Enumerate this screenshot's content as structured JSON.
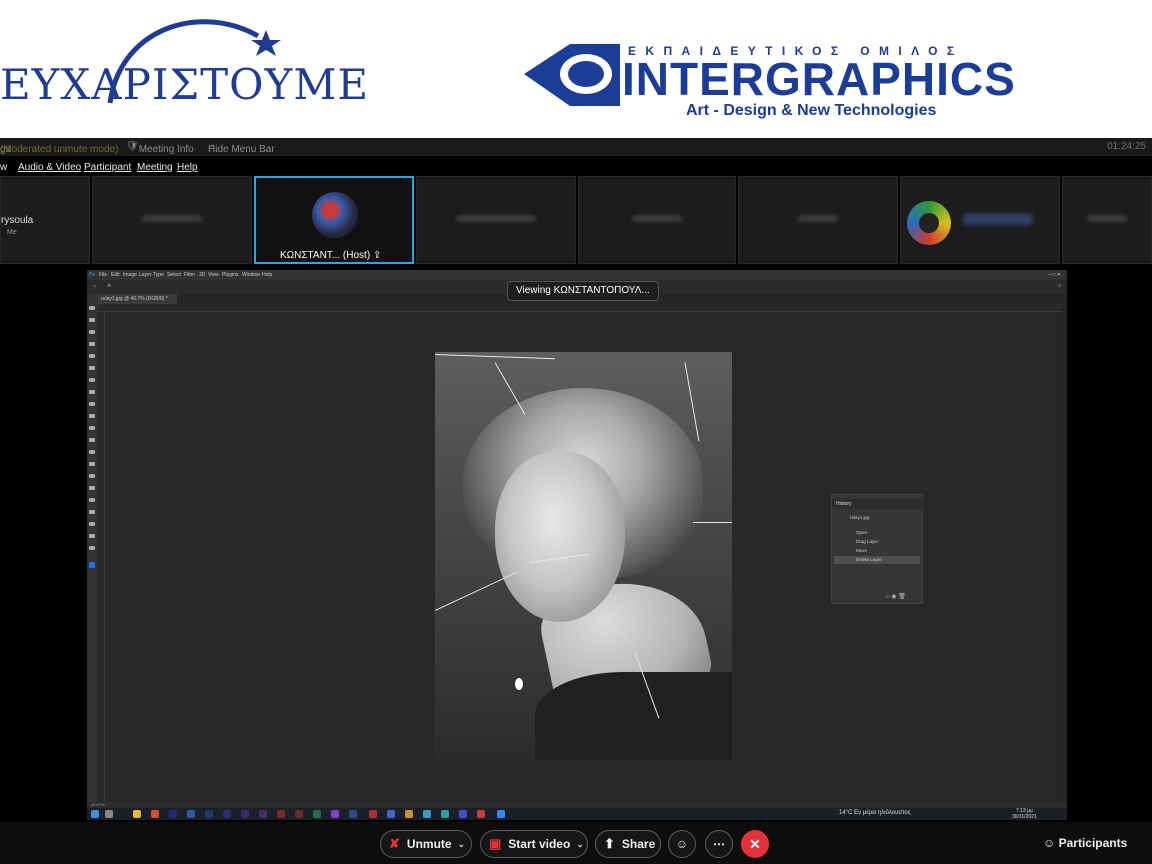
{
  "banner": {
    "thanks": "ΕΥΧΑΡΙΣΤΟΥΜΕ",
    "org_subtitle": "ΕΚΠΑΙΔΕΥΤΙΚΟΣ ΟΜΙΛΟΣ",
    "org_name": "INTERGRAPHICS",
    "tagline": "Art - Design & New Technologies"
  },
  "meeting_bar": {
    "title_prefix": "gs",
    "mode": "(Moderated unmute mode)",
    "info": "Meeting Info",
    "hide_menu": "Hide Menu Bar",
    "timer": "01:24:25"
  },
  "menu": [
    "w",
    "Audio & Video",
    "Participant",
    "Meeting",
    "Help"
  ],
  "thumbnails": {
    "self_name": "rysoula",
    "self_sub": "Me",
    "host_label": "ΚΩΝΣΤΑΝΤ... (Host)"
  },
  "viewing": "Viewing ΚΩΝΣΤΑΝΤΟΠΟΥΛ...",
  "photoshop": {
    "menu": [
      "File",
      "Edit",
      "Image",
      "Layer",
      "Type",
      "Select",
      "Filter",
      "3D",
      "View",
      "Plugins",
      "Window",
      "Help"
    ],
    "doc_tab": "relay1.jpg @ 46.7% (RGB/8) *",
    "status": "46.67%",
    "history": {
      "title": "History",
      "snapshot": "relay1.jpg",
      "items": [
        "Open",
        "Drag Layer",
        "Move",
        "Delete Layer"
      ]
    },
    "taskbar": {
      "weather": "14°C  Εν μέρει ηλιόλουστος",
      "time": "7:13 μμ",
      "date": "30/11/2021"
    }
  },
  "controls": {
    "unmute": "Unmute",
    "start_video": "Start video",
    "share": "Share",
    "participants": "Participants"
  },
  "colors": {
    "brand_blue": "#1c3d97",
    "host_border": "#28a7e0",
    "leave_red": "#e5323a"
  }
}
